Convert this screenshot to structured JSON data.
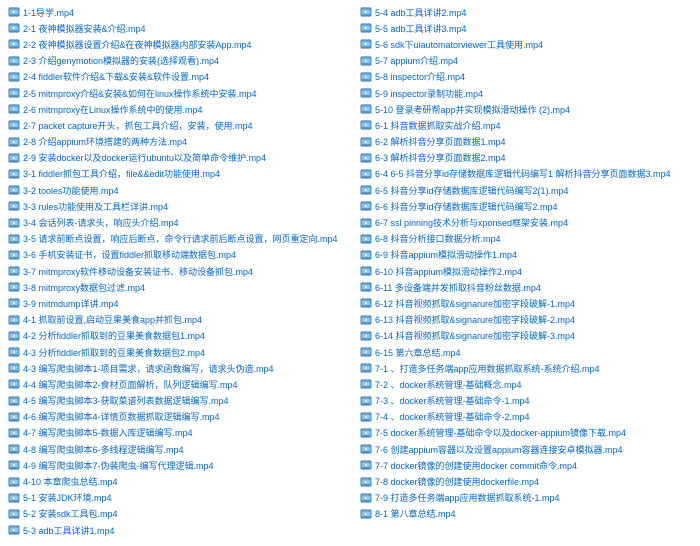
{
  "columns": [
    [
      "1-1导学.mp4",
      "2-1 夜神模拟器安装&介绍.mp4",
      "2-2 夜神模拟器设置介绍&在夜神模拟器内部安装App.mp4",
      "2-3 介绍genymotion模拟器的安装(选择观看).mp4",
      "2-4 fiddler软件介绍&下载&安装&软件设置.mp4",
      "2-5 mitmproxy介绍&安装&如何在linux操作系统中安装.mp4",
      "2-6 mitmproxy在Linux操作系统中的使用.mp4",
      "2-7 packet capture开头，抓包工具介绍，安装，使用.mp4",
      "2-8 介绍appium环境搭建的两种方法.mp4",
      "2-9 安装docker以及docker运行ubuntu以及简单命令维护.mp4",
      "3-1 fiddler抓包工具介绍，file&&edit功能使用.mp4",
      "3-2 tooles功能使用.mp4",
      "3-3 rules功能使用及工具栏详讲.mp4",
      "3-4 会话列表-请求头，响应头介绍.mp4",
      "3-5 请求前断点设置，响应后断点，命令行请求前后断点设置，网页重定向.mp4",
      "3-6 手机安装证书，设置fiddler抓取移动端数据包.mp4",
      "3-7 mitmproxy软件移动设备安装证书、移动设备抓包.mp4",
      "3-8 mitmproxy数据包过滤.mp4",
      "3-9 mitmdump详讲.mp4",
      "4-1 抓取前设置,启动豆果美食app并抓包.mp4",
      "4-2 分析fiddler抓取到的豆果美食数据包1.mp4",
      "4-3 分析fiddler抓取到的豆果美食数据包2.mp4",
      "4-3 编写爬虫脚本1-项目需求，请求函数编写，请求头伪造.mp4",
      "4-4 编写爬虫脚本2-食材页面解析，队列逻辑编写.mp4",
      "4-5 编写爬虫脚本3-获取菜谱列表数据逻辑编写.mp4",
      "4-6 编写爬虫脚本4-详情页数据抓取逻辑编写.mp4",
      "4-7 编写爬虫脚本5-数据入库逻辑编写.mp4",
      "4-8 编写爬虫脚本6-多线程逻辑编写.mp4",
      "4-9 编写爬虫脚本7-伪装爬虫-编写代理逻辑.mp4",
      "4-10 本章爬虫总结.mp4",
      "5-1 安装JDK环境.mp4",
      "5-2 安装sdk工具包.mp4",
      "5-3 adb工具详讲1.mp4"
    ],
    [
      "5-4 adb工具详讲2.mp4",
      "5-5 adb工具详讲3.mp4",
      "5-6 sdk下uiautomatorviewer工具使用.mp4",
      "5-7 appium介绍.mp4",
      "5-8 inspector介绍.mp4",
      "5-9 inspector录制功能.mp4",
      "5-10 登录考研帮app并实现模拟滑动操作 (2).mp4",
      "6-1 抖音数据抓取实战介绍.mp4",
      "6-2 解析抖音分享页面数据1.mp4",
      "6-3 解析抖音分享页面数据2.mp4",
      "6-4 6-5 抖音分享id存储数据库逻辑代码编写1 解析抖音分享页面数据3.mp4",
      "6-5 抖音分享id存储数据库逻辑代码编写2(1).mp4",
      "6-6 抖音分享id存储数据库逻辑代码编写2.mp4",
      "6-7 ssl pinning技术分析与xponsed框架安装.mp4",
      "6-8 抖音分析接口数据分析.mp4",
      "6-9 抖音appium模拟滑动操作1.mp4",
      "6-10 抖音appium模拟滑动操作2.mp4",
      "6-11 多设备端并发抓取抖音粉丝数据.mp4",
      "6-12 抖音视频抓取&signarure加密字段破解-1.mp4",
      "6-13 抖音视频抓取&signarure加密字段破解-2.mp4",
      "6-14 抖音视频抓取&signarure加密字段破解-3.mp4",
      "6-15 第六章总结.mp4",
      "7-1 、打造多任务端app应用数据抓取系统-系统介绍.mp4",
      "7-2 、docker系统管理-基础概念.mp4",
      "7-3 、docker系统管理-基础命令-1.mp4",
      "7-4 、docker系统管理-基础命令-2.mp4",
      "7-5 docker系统管理-基础命令以及docker-appium镜像下载.mp4",
      "7-6 创建appium容器以及设置appium容器连接安卓模拟器.mp4",
      "7-7 docker镜像的创建使用docker commit命令.mp4",
      "7-8 docker镜像的创建使用dockerfile.mp4",
      "7-9 打造多任务端app应用数据抓取系统-1.mp4",
      "8-1 第八章总结.mp4"
    ]
  ]
}
